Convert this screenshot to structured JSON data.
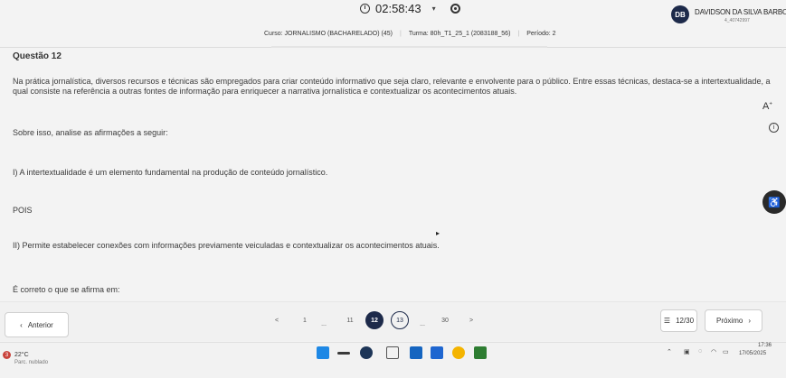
{
  "header": {
    "timer": "02:58:43",
    "avatar_initials": "DB",
    "user_name": "DAVIDSON DA SILVA BARBOSA",
    "user_id": "4_40742997"
  },
  "course_bar": {
    "course": "Curso: JORNALISMO (BACHARELADO) (45)",
    "turma": "Turma: 80h_T1_25_1 (2083188_56)",
    "period": "Período: 2"
  },
  "question": {
    "title": "Questão 12",
    "statement": "Na prática jornalística, diversos recursos e técnicas são empregados para criar conteúdo informativo que seja claro, relevante e envolvente para o público. Entre essas técnicas, destaca-se a intertextualidade, a qual consiste na referência a outras fontes de informação para enriquecer a narrativa jornalística e contextualizar os acontecimentos atuais.",
    "analyze": "Sobre isso, analise as afirmações a seguir:",
    "assertion_1": "I) A intertextualidade é um elemento fundamental na produção de conteúdo jornalístico.",
    "connector": "POIS",
    "assertion_2": "II) Permite estabelecer conexões com informações previamente veiculadas e contextualizar os acontecimentos atuais.",
    "prompt": "É correto o que se afirma em:"
  },
  "tools": {
    "font_size_label": "A",
    "info_label": "i"
  },
  "nav": {
    "prev_label": "Anterior",
    "next_label": "Próximo",
    "count_label": "12/30",
    "pager": {
      "prev_arrow": "<",
      "first": "1",
      "ellipsis_left": "...",
      "p11": "11",
      "current": "12",
      "p13": "13",
      "ellipsis_right": "...",
      "last": "30",
      "next_arrow": ">"
    }
  },
  "taskbar": {
    "weather_badge": "3",
    "temperature": "22°C",
    "weather_desc": "Parc. nublado",
    "time": "17:36",
    "date": "17/05/2025"
  },
  "colors": {
    "accent": "#1d2a4a",
    "background": "#f3f3f3",
    "weather_badge": "#c9433c"
  }
}
